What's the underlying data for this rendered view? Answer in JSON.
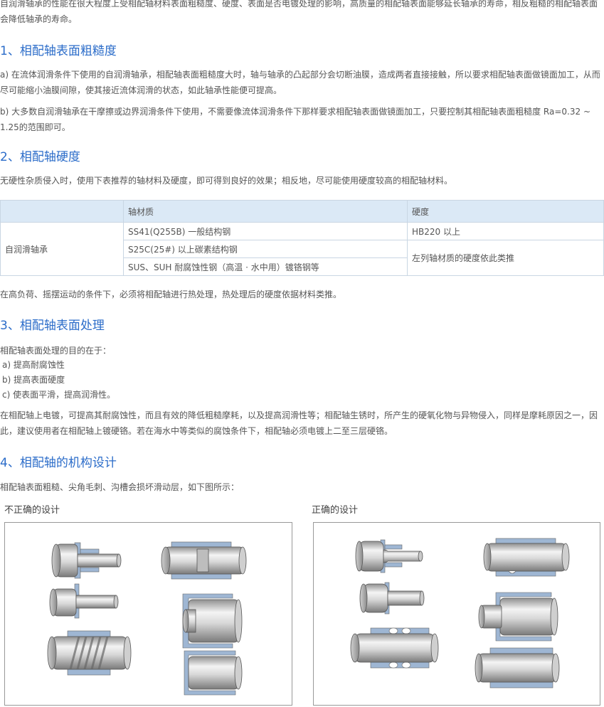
{
  "intro": "自润滑轴承的性能在很大程度上受相配轴材料表面粗糙度、硬度、表面是否电镀处理的影响，高质量的相配轴表面能够延长轴承的寿命，相反粗糙的相配轴表面会降低轴承的寿命。",
  "s1": {
    "title": "1、相配轴表面粗糙度",
    "a": "a) 在流体润滑条件下使用的自润滑轴承，相配轴表面粗糙度大时，轴与轴承的凸起部分会切断油膜，造成两者直接接触，所以要求相配轴表面做镜面加工，从而尽可能缩小油膜间隙，使其接近流体润滑的状态，如此轴承性能便可提高。",
    "b": "b) 大多数自润滑轴承在干摩擦或边界润滑条件下使用，不需要像流体润滑条件下那样要求相配轴表面做镜面加工，只要控制其相配轴表面粗糙度 Ra=0.32 ~ 1.25的范围即可。"
  },
  "s2": {
    "title": "2、相配轴硬度",
    "intro": "无硬性杂质侵入时，使用下表推荐的轴材料及硬度，即可得到良好的效果；相反地，尽可能使用硬度较高的相配轴材料。",
    "table": {
      "headers": [
        "",
        "轴材质",
        "硬度"
      ],
      "row_label": "自润滑轴承",
      "materials": [
        "SS41(Q255B) 一般结构钢",
        "S25C(25#) 以上碳素结构钢",
        "SUS、SUH 耐腐蚀性钢（高温 · 水中用）镀铬钢等"
      ],
      "hardness_1": "HB220 以上",
      "hardness_2": "左列轴材质的硬度依此类推"
    },
    "note": "在高负荷、摇摆运动的条件下，必须将相配轴进行热处理，热处理后的硬度依据材料类推。"
  },
  "s3": {
    "title": "3、相配轴表面处理",
    "purpose": "相配轴表面处理的目的在于：",
    "items": [
      "a) 提高耐腐蚀性",
      "b) 提高表面硬度",
      "c) 使表面平滑，提高润滑性。"
    ],
    "para": "在相配轴上电镀，可提高其耐腐蚀性，而且有效的降低粗糙摩耗，以及提高润滑性等；相配轴生锈时，所产生的硬氧化物与异物侵入，同样是摩耗原因之一，因此，建议使用者在相配轴上镀硬铬。若在海水中等类似的腐蚀条件下，相配轴必须电镀上二至三层硬铬。"
  },
  "s4": {
    "title": "4、相配轴的机构设计",
    "intro": "相配轴表面粗糙、尖角毛刺、沟槽会损坏滑动层，如下图所示：",
    "wrong_caption": "不正确的设计",
    "right_caption": "正确的设计"
  },
  "colors": {
    "heading": "#2b6cc9",
    "table_header": "#dbe9f6",
    "bearing": "#9eb6d3"
  }
}
